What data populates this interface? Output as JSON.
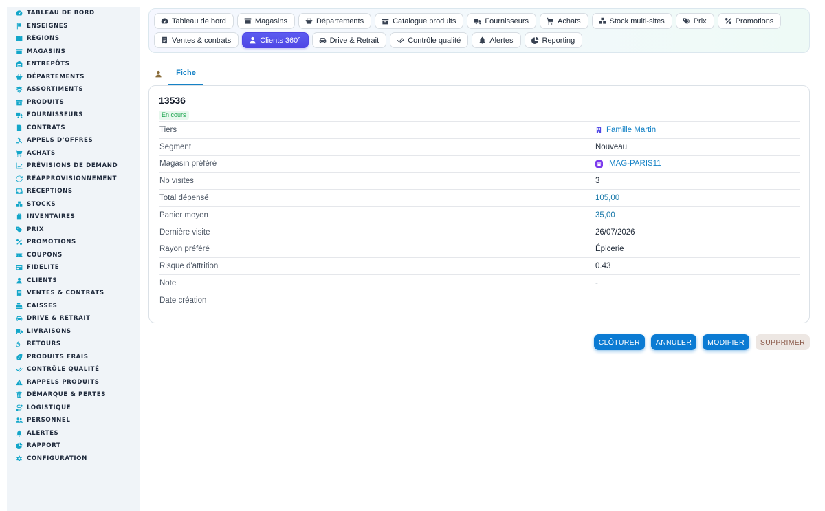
{
  "sidebar": {
    "items": [
      {
        "label": "TABLEAU DE BORD",
        "icon": "dashboard-icon"
      },
      {
        "label": "ENSEIGNES",
        "icon": "flag-icon"
      },
      {
        "label": "RÉGIONS",
        "icon": "map-icon"
      },
      {
        "label": "MAGASINS",
        "icon": "store-icon"
      },
      {
        "label": "ENTREPÔTS",
        "icon": "warehouse-icon"
      },
      {
        "label": "DÉPARTEMENTS",
        "icon": "basket-icon"
      },
      {
        "label": "ASSORTIMENTS",
        "icon": "layers-icon"
      },
      {
        "label": "PRODUITS",
        "icon": "box-icon"
      },
      {
        "label": "FOURNISSEURS",
        "icon": "truck-icon"
      },
      {
        "label": "CONTRATS",
        "icon": "file-icon"
      },
      {
        "label": "APPELS D'OFFRES",
        "icon": "gavel-icon"
      },
      {
        "label": "ACHATS",
        "icon": "cart-icon"
      },
      {
        "label": "PRÉVISIONS DE DEMAND",
        "icon": "chart-line-icon"
      },
      {
        "label": "RÉAPPROVISIONNEMENT",
        "icon": "refresh-icon"
      },
      {
        "label": "RÉCEPTIONS",
        "icon": "inbox-icon"
      },
      {
        "label": "STOCKS",
        "icon": "cubes-icon"
      },
      {
        "label": "INVENTAIRES",
        "icon": "clipboard-icon"
      },
      {
        "label": "PRIX",
        "icon": "tag-icon"
      },
      {
        "label": "PROMOTIONS",
        "icon": "percent-icon"
      },
      {
        "label": "COUPONS",
        "icon": "ticket-icon"
      },
      {
        "label": "FIDELITE",
        "icon": "card-icon"
      },
      {
        "label": "CLIENTS",
        "icon": "user-icon"
      },
      {
        "label": "VENTES & CONTRATS",
        "icon": "receipt-icon"
      },
      {
        "label": "CAISSES",
        "icon": "cash-register-icon"
      },
      {
        "label": "DRIVE & RETRAIT",
        "icon": "car-icon"
      },
      {
        "label": "LIVRAISONS",
        "icon": "delivery-icon"
      },
      {
        "label": "RETOURS",
        "icon": "undo-icon"
      },
      {
        "label": "PRODUITS FRAIS",
        "icon": "leaf-icon"
      },
      {
        "label": "CONTRÔLE QUALITÉ",
        "icon": "check-double-icon"
      },
      {
        "label": "RAPPELS PRODUITS",
        "icon": "warning-icon"
      },
      {
        "label": "DÉMARQUE & PERTES",
        "icon": "trash-icon"
      },
      {
        "label": "LOGISTIQUE",
        "icon": "route-icon"
      },
      {
        "label": "PERSONNEL",
        "icon": "users-icon"
      },
      {
        "label": "ALERTES",
        "icon": "bell-icon"
      },
      {
        "label": "RAPPORT",
        "icon": "pie-icon"
      },
      {
        "label": "CONFIGURATION",
        "icon": "gear-icon"
      }
    ]
  },
  "topmenu": {
    "row1": [
      {
        "label": "Tableau de bord",
        "icon": "dashboard-icon"
      },
      {
        "label": "Magasins",
        "icon": "store-icon"
      },
      {
        "label": "Départements",
        "icon": "basket-icon"
      },
      {
        "label": "Catalogue produits",
        "icon": "box-icon"
      },
      {
        "label": "Fournisseurs",
        "icon": "truck-icon"
      },
      {
        "label": "Achats",
        "icon": "cart-icon"
      },
      {
        "label": "Stock multi-sites",
        "icon": "cubes-icon"
      },
      {
        "label": "Prix",
        "icon": "tags-icon"
      },
      {
        "label": "Promotions",
        "icon": "percent-icon"
      }
    ],
    "row2": [
      {
        "label": "Ventes & contrats",
        "icon": "receipt-icon"
      },
      {
        "label": "Clients 360°",
        "icon": "user-icon",
        "active": true
      },
      {
        "label": "Drive & Retrait",
        "icon": "car-icon"
      },
      {
        "label": "Contrôle qualité",
        "icon": "check-double-icon"
      },
      {
        "label": "Alertes",
        "icon": "bell-icon"
      },
      {
        "label": "Reporting",
        "icon": "pie-icon"
      }
    ]
  },
  "tabs": {
    "fiche_label": "Fiche"
  },
  "record": {
    "title": "13536",
    "status": "En cours",
    "fields": [
      {
        "label": "Tiers",
        "value": "Famille Martin",
        "kind": "link-tiers"
      },
      {
        "label": "Segment",
        "value": "Nouveau",
        "kind": "text"
      },
      {
        "label": "Magasin préféré",
        "value": "MAG-PARIS11",
        "kind": "link-store"
      },
      {
        "label": "Nb visites",
        "value": "3",
        "kind": "text"
      },
      {
        "label": "Total dépensé",
        "value": "105,00",
        "kind": "num"
      },
      {
        "label": "Panier moyen",
        "value": "35,00",
        "kind": "num"
      },
      {
        "label": "Dernière visite",
        "value": "26/07/2026",
        "kind": "text"
      },
      {
        "label": "Rayon préféré",
        "value": "Épicerie",
        "kind": "text"
      },
      {
        "label": "Risque d'attrition",
        "value": "0.43",
        "kind": "text"
      },
      {
        "label": "Note",
        "value": "-",
        "kind": "muted"
      },
      {
        "label": "Date création",
        "value": "",
        "kind": "text"
      }
    ]
  },
  "actions": {
    "close_label": "CLÔTURER",
    "cancel_label": "ANNULER",
    "edit_label": "MODIFIER",
    "delete_label": "SUPPRIMER"
  },
  "colors": {
    "accent": "#1582c6",
    "active_menu": "#4f46e5",
    "primary_button": "#0b7bd3",
    "status_green": "#16a34a",
    "sidebar_icon": "#13a6c9"
  }
}
